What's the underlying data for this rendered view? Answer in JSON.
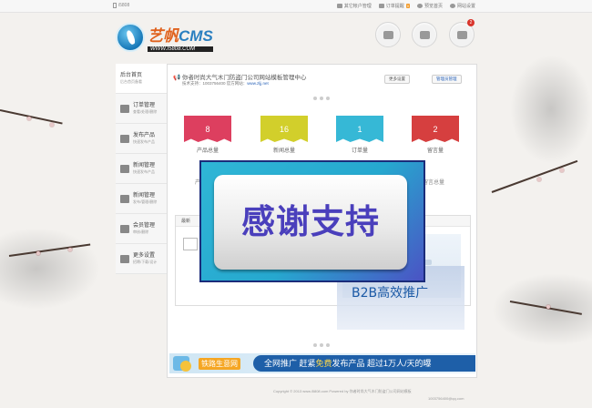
{
  "topbar": {
    "site": "i5808",
    "links": [
      {
        "label": "其它帐户管理",
        "icon": "document-icon"
      },
      {
        "label": "订单提醒",
        "icon": "mail-icon",
        "badge": "0"
      },
      {
        "label": "预览首页",
        "icon": "cloud-icon"
      },
      {
        "label": "网站设置",
        "icon": "gear-icon"
      }
    ]
  },
  "logo": {
    "title_main": "艺帆",
    "title_cms": "CMS",
    "url": "WWW.I5808.COM"
  },
  "header_buttons": [
    {
      "icon": "user-icon"
    },
    {
      "icon": "truck-icon"
    },
    {
      "icon": "chat-icon",
      "badge": "2"
    }
  ],
  "sidebar": {
    "items": [
      {
        "label": "后台首页",
        "sub": "后台首页备看"
      },
      {
        "label": "订单管理",
        "sub": "查看/处理/删除"
      },
      {
        "label": "发布产品",
        "sub": "快速发布产品"
      },
      {
        "label": "新闻管理",
        "sub": "快速发布产品"
      },
      {
        "label": "新闻管理",
        "sub": "发布/管理/删除"
      },
      {
        "label": "会员管理",
        "sub": "审核/删除"
      },
      {
        "label": "更多设置",
        "sub": "招聘/下载/设计"
      }
    ]
  },
  "main": {
    "welcome": "你者时尚大气木门防盗门公司网站模板管理中心",
    "support_prefix": "技术支持：1003756400 官方网站：",
    "support_link": "www.zljj.net",
    "btn_more": "更多设置",
    "btn_password": "管理员管理",
    "stats": [
      {
        "value": "8",
        "label": "产品总量",
        "color": "#dd3f5f"
      },
      {
        "value": "16",
        "label": "新闻总量",
        "color": "#d2cf2b"
      },
      {
        "value": "1",
        "label": "订单量",
        "color": "#36b8d6"
      },
      {
        "value": "2",
        "label": "留言量",
        "color": "#d63f3f"
      }
    ],
    "stats_row2_left": "产",
    "stats_row2_right": "留言总量",
    "box_title": "最新"
  },
  "promo": {
    "text": "感谢支持",
    "side_line1": "信息",
    "side_line2": "B2B高效推广"
  },
  "banner": {
    "tag": "铁路生意网",
    "slogan_a": "全网推广  赶紧",
    "slogan_hl": "免费",
    "slogan_b": "发布产品  超过1万人/天的曝"
  },
  "footer": {
    "line1": "Copyright © 2013 www.i5808.com Powered by 你者时尚大气木门防盗门公司网站模板",
    "line2": "1003756400@qq.com"
  },
  "colors": {
    "accent": "#2a63b8",
    "brand_orange": "#e0621e"
  }
}
